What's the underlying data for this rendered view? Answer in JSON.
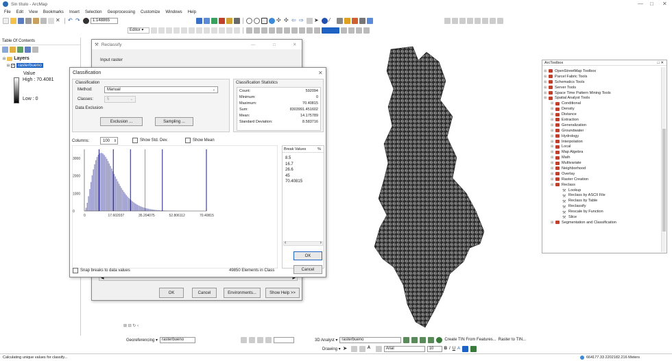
{
  "window": {
    "title": "Sin título - ArcMap",
    "controls": [
      "—",
      "□",
      "✕"
    ]
  },
  "menu": [
    "File",
    "Edit",
    "View",
    "Bookmarks",
    "Insert",
    "Selection",
    "Geoprocessing",
    "Customize",
    "Windows",
    "Help"
  ],
  "toolbar": {
    "scale": "1:148865",
    "editor": "Editor ▾"
  },
  "toc": {
    "title": "Table Of Contents",
    "group": "Layers",
    "layer": "rasterbueno",
    "value_label": "Value",
    "high": "High : 70.4081",
    "low": "Low : 0"
  },
  "reclassify": {
    "title": "Reclassify",
    "input_label": "Input raster",
    "buttons": {
      "ok": "OK",
      "cancel": "Cancel",
      "env": "Environments...",
      "help": "Show Help >>"
    }
  },
  "classification": {
    "title": "Classification",
    "section_classification": "Classification",
    "method_label": "Method:",
    "method_value": "Manual",
    "classes_label": "Classes:",
    "classes_value": "5",
    "data_exclusion": "Data Exclusion",
    "exclusion_btn": "Exclusion ...",
    "sampling_btn": "Sampling ...",
    "stats_title": "Classification Statistics",
    "stats": [
      {
        "k": "Count:",
        "v": "592094"
      },
      {
        "k": "Minimum:",
        "v": "0"
      },
      {
        "k": "Maximum:",
        "v": "70.40815"
      },
      {
        "k": "Sum:",
        "v": "8303991.451602"
      },
      {
        "k": "Mean:",
        "v": "14.175789"
      },
      {
        "k": "Standard Deviation:",
        "v": "8.583716"
      }
    ],
    "columns_label": "Columns:",
    "columns_value": "100",
    "show_std": "Show Std. Dev.",
    "show_mean": "Show Mean",
    "break_values_label": "Break Values",
    "pct": "%",
    "break_values": [
      "8.5",
      "16.7",
      "26.6",
      "45",
      "70.40815"
    ],
    "y_ticks": [
      "3000",
      "2000",
      "1000",
      "0"
    ],
    "x_ticks": [
      "0",
      "17.602037",
      "35.204075",
      "52.806112",
      "70.40815"
    ],
    "snap_label": "Snap breaks to data values",
    "elements": "49850 Elements in Class",
    "ok": "OK",
    "cancel": "Cancel",
    "close": "✕"
  },
  "chart_data": {
    "type": "bar",
    "title": "",
    "xlabel": "",
    "ylabel": "",
    "xlim": [
      0,
      70.40815
    ],
    "ylim": [
      0,
      3500
    ],
    "histogram_peak_x": 10,
    "break_lines": [
      8.5,
      16.7,
      26.6,
      45,
      70.40815
    ],
    "x_ticks": [
      0,
      17.602037,
      35.204075,
      52.806112,
      70.40815
    ],
    "y_ticks": [
      0,
      1000,
      2000,
      3000
    ]
  },
  "arctoolbox": {
    "title": "ArcToolbox",
    "close": "□ ✕",
    "items": [
      {
        "label": "OpenStreetMap Toolbox",
        "indent": 0,
        "kind": "box"
      },
      {
        "label": "Parcel Fabric Tools",
        "indent": 0,
        "kind": "box"
      },
      {
        "label": "Schematics Tools",
        "indent": 0,
        "kind": "box"
      },
      {
        "label": "Server Tools",
        "indent": 0,
        "kind": "box"
      },
      {
        "label": "Space Time Pattern Mining Tools",
        "indent": 0,
        "kind": "box"
      },
      {
        "label": "Spatial Analyst Tools",
        "indent": 0,
        "kind": "box"
      },
      {
        "label": "Conditional",
        "indent": 1,
        "kind": "set"
      },
      {
        "label": "Density",
        "indent": 1,
        "kind": "set"
      },
      {
        "label": "Distance",
        "indent": 1,
        "kind": "set"
      },
      {
        "label": "Extraction",
        "indent": 1,
        "kind": "set"
      },
      {
        "label": "Generalization",
        "indent": 1,
        "kind": "set"
      },
      {
        "label": "Groundwater",
        "indent": 1,
        "kind": "set"
      },
      {
        "label": "Hydrology",
        "indent": 1,
        "kind": "set"
      },
      {
        "label": "Interpolation",
        "indent": 1,
        "kind": "set"
      },
      {
        "label": "Local",
        "indent": 1,
        "kind": "set"
      },
      {
        "label": "Map Algebra",
        "indent": 1,
        "kind": "set"
      },
      {
        "label": "Math",
        "indent": 1,
        "kind": "set"
      },
      {
        "label": "Multivariate",
        "indent": 1,
        "kind": "set"
      },
      {
        "label": "Neighborhood",
        "indent": 1,
        "kind": "set"
      },
      {
        "label": "Overlay",
        "indent": 1,
        "kind": "set"
      },
      {
        "label": "Raster Creation",
        "indent": 1,
        "kind": "set"
      },
      {
        "label": "Reclass",
        "indent": 1,
        "kind": "set"
      },
      {
        "label": "Lookup",
        "indent": 2,
        "kind": "tool"
      },
      {
        "label": "Reclass by ASCII File",
        "indent": 2,
        "kind": "tool"
      },
      {
        "label": "Reclass by Table",
        "indent": 2,
        "kind": "tool"
      },
      {
        "label": "Reclassify",
        "indent": 2,
        "kind": "tool"
      },
      {
        "label": "Rescale by Function",
        "indent": 2,
        "kind": "tool"
      },
      {
        "label": "Slice",
        "indent": 2,
        "kind": "tool"
      },
      {
        "label": "Segmentation and Classification",
        "indent": 1,
        "kind": "set"
      }
    ]
  },
  "bottom": {
    "georef": "Georeferencing ▾",
    "georef_layer": "rasterbueno",
    "analyst3d": "3D Analyst ▾",
    "analyst_layer": "rasterbueno",
    "create_tin": "Create TIN From Features...",
    "raster_to_tin": "Raster to TIN...",
    "drawing": "Drawing ▾",
    "font": "Arial",
    "font_size": "10"
  },
  "status": {
    "text": "Calculating unique values for classify...",
    "coords": "664177.33  2202182.216 Meters"
  },
  "colors": {
    "accent": "#1e63c4",
    "break_line": "#1a1a80",
    "mean_line": "#d02020",
    "hist_bar": "#9898c8"
  }
}
